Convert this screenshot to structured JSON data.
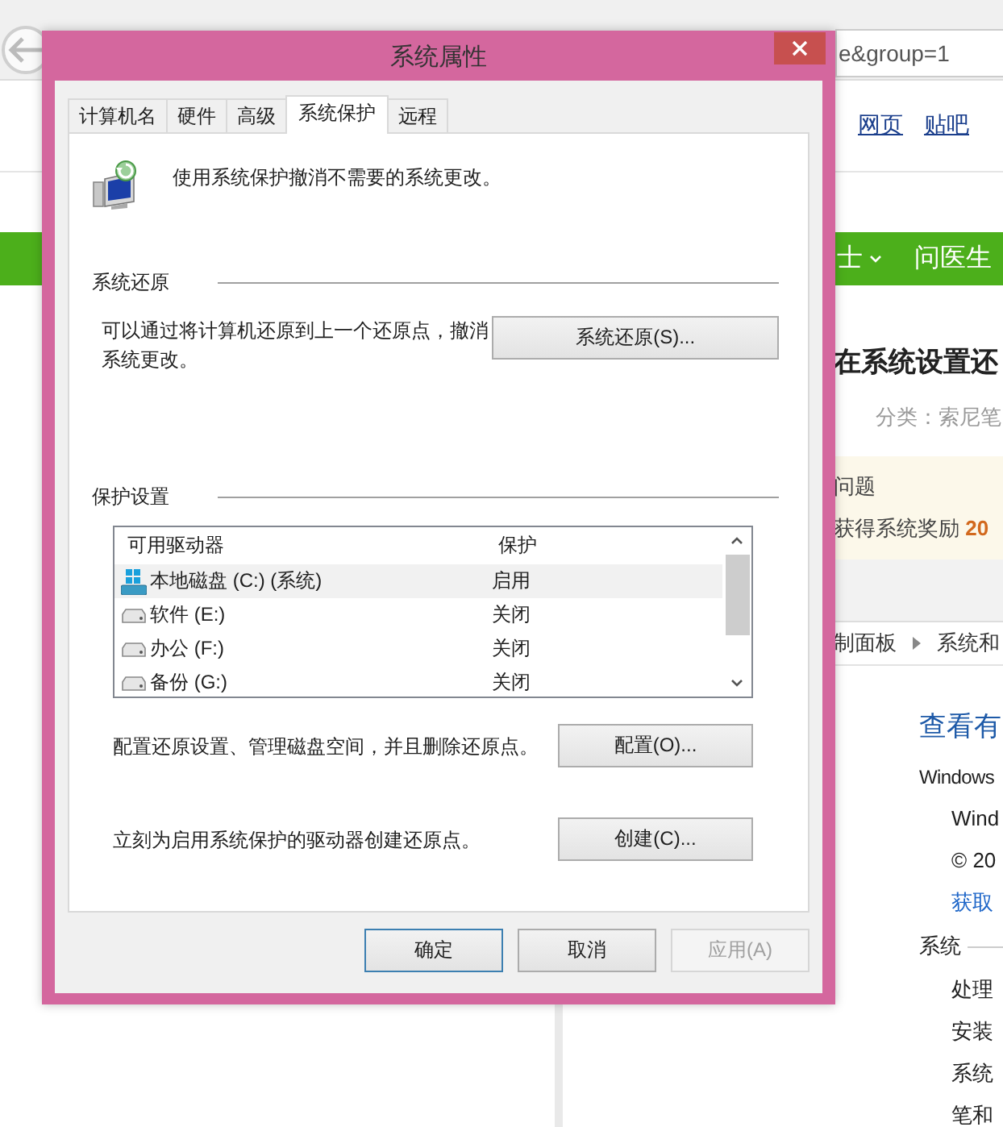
{
  "browser": {
    "address": "e&group=1",
    "header_links": [
      {
        "label": "网页",
        "kind": "link"
      },
      {
        "label": "贴吧",
        "kind": "link"
      }
    ],
    "nav": [
      {
        "label": "士",
        "dropdown": true
      },
      {
        "label": "问医生",
        "dropdown": false
      }
    ],
    "question": {
      "title": "在系统设置还",
      "category": "分类：索尼笔"
    },
    "notice": {
      "title": "问题",
      "reward": "获得系统奖励 **20**"
    },
    "breadcrumb": [
      "制面板",
      "系统和"
    ],
    "info": {
      "heading": "查看有",
      "edition_label": "Windows",
      "lines": [
        {
          "text": "Wind",
          "kind": "plain"
        },
        {
          "text": "© 20",
          "kind": "plain"
        },
        {
          "text": "获取",
          "kind": "link"
        }
      ],
      "section": "系统",
      "items": [
        "处理",
        "安装",
        "系统",
        "笔和"
      ]
    }
  },
  "dialog": {
    "title": "系统属性",
    "tabs": [
      {
        "label": "计算机名",
        "selected": false
      },
      {
        "label": "硬件",
        "selected": false
      },
      {
        "label": "高级",
        "selected": false
      },
      {
        "label": "系统保护",
        "selected": true
      },
      {
        "label": "远程",
        "selected": false
      }
    ],
    "intro": "使用系统保护撤消不需要的系统更改。",
    "restore": {
      "heading": "系统还原",
      "text": "可以通过将计算机还原到上一个还原点，撤消系统更改。",
      "button": "系统还原(S)..."
    },
    "protection": {
      "heading": "保护设置",
      "columns": [
        "可用驱动器",
        "保护"
      ],
      "drives": [
        {
          "name": "本地磁盘 (C:) (系统)",
          "protection": "启用",
          "kind": "system",
          "selected": true
        },
        {
          "name": "软件 (E:)",
          "protection": "关闭",
          "kind": "disk",
          "selected": false
        },
        {
          "name": "办公 (F:)",
          "protection": "关闭",
          "kind": "disk",
          "selected": false
        },
        {
          "name": "备份 (G:)",
          "protection": "关闭",
          "kind": "disk",
          "selected": false
        }
      ],
      "configure_text": "配置还原设置、管理磁盘空间，并且删除还原点。",
      "configure_button": "配置(O)...",
      "create_text": "立刻为启用系统保护的驱动器创建还原点。",
      "create_button": "创建(C)..."
    },
    "buttons": [
      {
        "label": "确定",
        "kind": "default",
        "disabled": false
      },
      {
        "label": "取消",
        "kind": "normal",
        "disabled": false
      },
      {
        "label": "应用(A)",
        "kind": "normal",
        "disabled": true
      }
    ]
  }
}
